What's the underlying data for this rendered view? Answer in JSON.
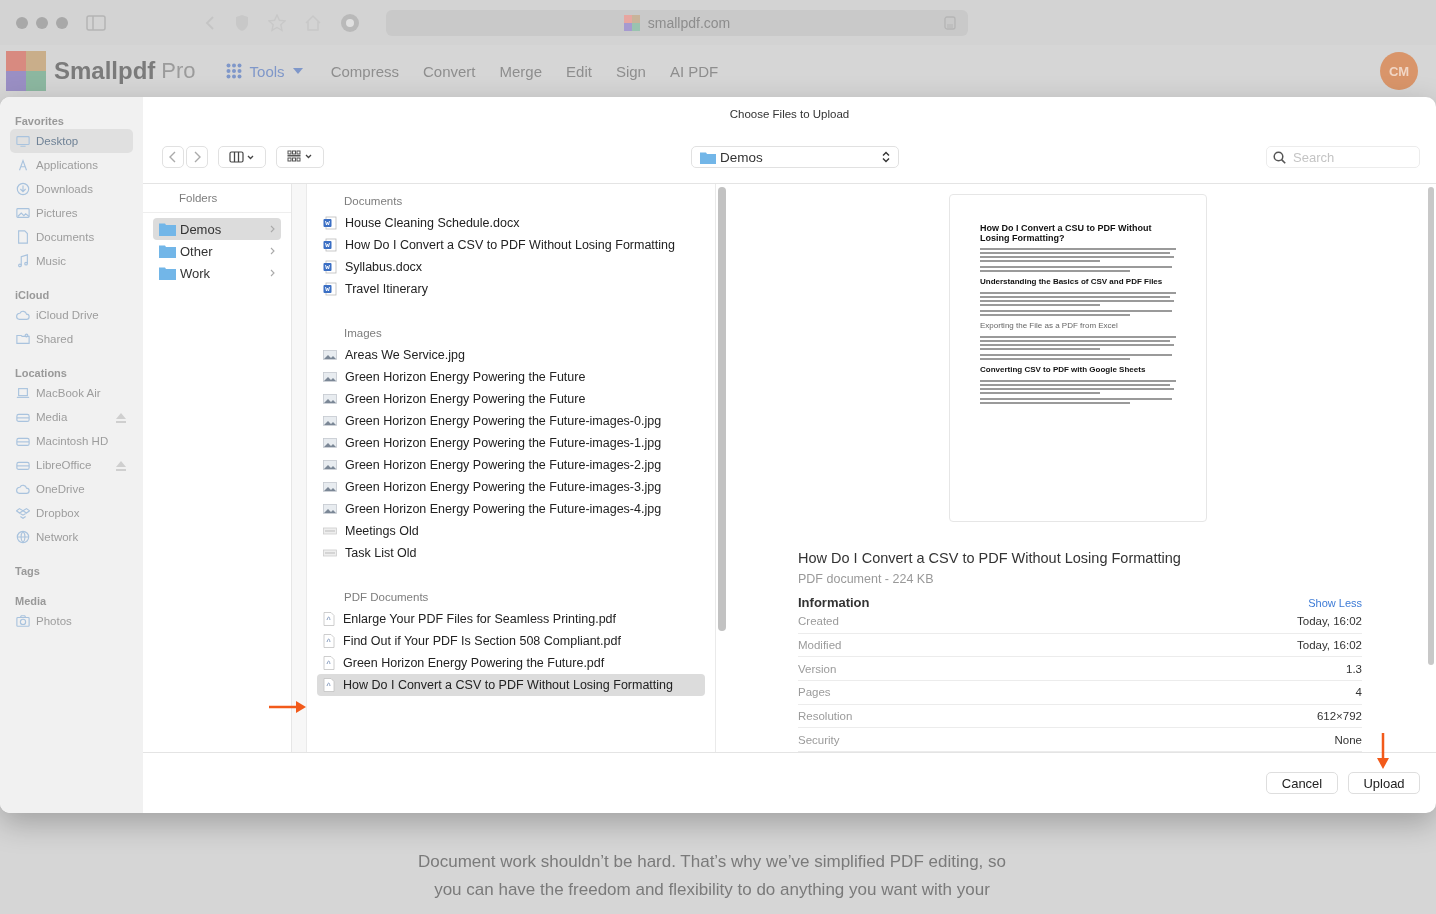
{
  "browser": {
    "url": "smallpdf.com"
  },
  "site": {
    "brand": "Smallpdf",
    "plan": "Pro",
    "tools": "Tools",
    "nav": [
      "Compress",
      "Convert",
      "Merge",
      "Edit",
      "Sign",
      "AI PDF"
    ],
    "avatar": "CM"
  },
  "page": {
    "text": "Document work shouldn’t be hard. That’s why we’ve simplified PDF editing, so you can have the freedom and flexibility to do anything you want with your"
  },
  "dialog": {
    "title": "Choose Files to Upload",
    "location": "Demos",
    "search_placeholder": "Search",
    "sidebar": [
      {
        "heading": "Favorites",
        "items": [
          {
            "label": "Desktop",
            "kind": "desktop",
            "selected": true,
            "eject": false
          },
          {
            "label": "Applications",
            "kind": "apps",
            "selected": false,
            "eject": false
          },
          {
            "label": "Downloads",
            "kind": "download",
            "selected": false,
            "eject": false
          },
          {
            "label": "Pictures",
            "kind": "picture",
            "selected": false,
            "eject": false
          },
          {
            "label": "Documents",
            "kind": "document",
            "selected": false,
            "eject": false
          },
          {
            "label": "Music",
            "kind": "music",
            "selected": false,
            "eject": false
          }
        ]
      },
      {
        "heading": "iCloud",
        "items": [
          {
            "label": "iCloud Drive",
            "kind": "cloud",
            "selected": false,
            "eject": false
          },
          {
            "label": "Shared",
            "kind": "shared",
            "selected": false,
            "eject": false
          }
        ]
      },
      {
        "heading": "Locations",
        "items": [
          {
            "label": "MacBook Air",
            "kind": "laptop",
            "selected": false,
            "eject": false
          },
          {
            "label": "Media",
            "kind": "drive",
            "selected": false,
            "eject": true
          },
          {
            "label": "Macintosh HD",
            "kind": "drive",
            "selected": false,
            "eject": false
          },
          {
            "label": "LibreOffice",
            "kind": "drive",
            "selected": false,
            "eject": true
          },
          {
            "label": "OneDrive",
            "kind": "cloud",
            "selected": false,
            "eject": false
          },
          {
            "label": "Dropbox",
            "kind": "box",
            "selected": false,
            "eject": false
          },
          {
            "label": "Network",
            "kind": "globe",
            "selected": false,
            "eject": false
          }
        ]
      },
      {
        "heading": "Tags"
      },
      {
        "heading": "Media",
        "items": [
          {
            "label": "Photos",
            "kind": "camera",
            "selected": false,
            "eject": false
          }
        ]
      }
    ],
    "folders": {
      "heading": "Folders",
      "items": [
        {
          "label": "Demos",
          "selected": true
        },
        {
          "label": "Other",
          "selected": false
        },
        {
          "label": "Work",
          "selected": false
        }
      ]
    },
    "groups": [
      {
        "heading": "Documents",
        "items": [
          {
            "name": "House Cleaning Schedule.docx",
            "kind": "word",
            "selected": false
          },
          {
            "name": "How Do I Convert a CSV to PDF Without Losing Formatting",
            "kind": "word",
            "selected": false
          },
          {
            "name": "Syllabus.docx",
            "kind": "word",
            "selected": false
          },
          {
            "name": "Travel Itinerary",
            "kind": "word",
            "selected": false
          }
        ]
      },
      {
        "heading": "Images",
        "items": [
          {
            "name": "Areas We Service.jpg",
            "kind": "image",
            "selected": false
          },
          {
            "name": "Green Horizon Energy Powering the Future",
            "kind": "image",
            "selected": false
          },
          {
            "name": "Green Horizon Energy Powering the Future",
            "kind": "image",
            "selected": false
          },
          {
            "name": "Green Horizon Energy Powering the Future-images-0.jpg",
            "kind": "image",
            "selected": false
          },
          {
            "name": "Green Horizon Energy Powering the Future-images-1.jpg",
            "kind": "image",
            "selected": false
          },
          {
            "name": "Green Horizon Energy Powering the Future-images-2.jpg",
            "kind": "image",
            "selected": false
          },
          {
            "name": "Green Horizon Energy Powering the Future-images-3.jpg",
            "kind": "image",
            "selected": false
          },
          {
            "name": "Green Horizon Energy Powering the Future-images-4.jpg",
            "kind": "image",
            "selected": false
          },
          {
            "name": "Meetings Old",
            "kind": "text",
            "selected": false
          },
          {
            "name": "Task List Old",
            "kind": "text",
            "selected": false
          }
        ]
      },
      {
        "heading": "PDF Documents",
        "items": [
          {
            "name": "Enlarge Your PDF Files for Seamless Printing.pdf",
            "kind": "pdf",
            "selected": false
          },
          {
            "name": "Find Out if Your PDF Is Section 508 Compliant.pdf",
            "kind": "pdf",
            "selected": false
          },
          {
            "name": "Green Horizon Energy Powering the Future.pdf",
            "kind": "pdf",
            "selected": false
          },
          {
            "name": "How Do I Convert a CSV to PDF Without Losing Formatting",
            "kind": "pdf",
            "selected": true
          }
        ]
      }
    ],
    "preview": {
      "headings": [
        "How Do I Convert a CSU to PDF Without Losing Formatting?",
        "Understanding the Basics of CSV and PDF Files",
        "Exporting the File as a PDF from Excel",
        "Converting CSV to PDF with Google Sheets"
      ],
      "name": "How Do I Convert a CSV to PDF Without Losing Formatting",
      "meta": "PDF document - 224 KB",
      "info_heading": "Information",
      "toggle": "Show Less",
      "rows": [
        {
          "label": "Created",
          "value": "Today, 16:02"
        },
        {
          "label": "Modified",
          "value": "Today, 16:02"
        },
        {
          "label": "Version",
          "value": "1.3"
        },
        {
          "label": "Pages",
          "value": "4"
        },
        {
          "label": "Resolution",
          "value": "612×792"
        },
        {
          "label": "Security",
          "value": "None"
        }
      ]
    },
    "buttons": [
      "Cancel",
      "Upload"
    ]
  }
}
